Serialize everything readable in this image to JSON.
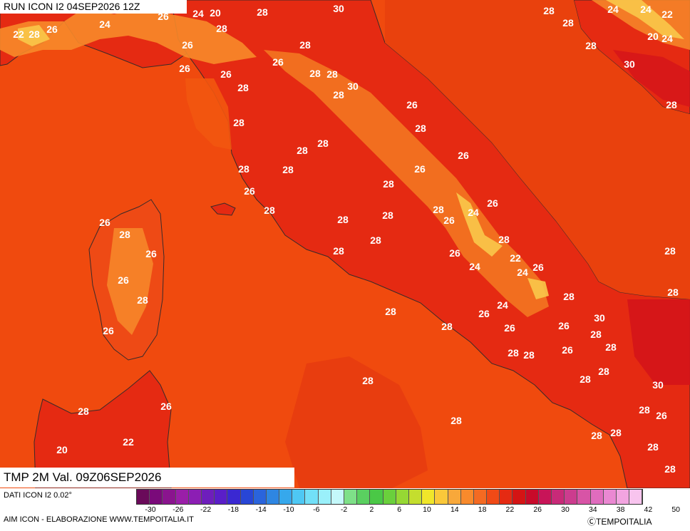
{
  "header": {
    "run": "RUN ICON I2 04SEP2026 12Z",
    "variable": "TMP 2M Val. 09Z06SEP2026"
  },
  "map": {
    "colors": {
      "sea": "#f04a0e",
      "land_hot": "#e52a12",
      "land_warm": "#ee4a15",
      "mountain": "#f78a2a",
      "peak": "#f9c84a",
      "coast": "#3a2a2a",
      "border": "#8a6a6a",
      "label": "#ffffff"
    },
    "labels": [
      "28",
      "30",
      "26",
      "24",
      "20",
      "22",
      "28",
      "26",
      "24",
      "28",
      "26",
      "26",
      "28",
      "26",
      "28",
      "28",
      "26",
      "28",
      "30",
      "28",
      "26",
      "28",
      "28",
      "28",
      "28",
      "26",
      "28",
      "28",
      "26",
      "26",
      "28",
      "28",
      "28",
      "28",
      "28",
      "28",
      "28",
      "26",
      "24",
      "26",
      "26",
      "28",
      "26",
      "26",
      "28",
      "26",
      "28",
      "22",
      "24",
      "26",
      "26",
      "24",
      "28",
      "28",
      "26",
      "28",
      "28",
      "24",
      "26",
      "26",
      "28",
      "30",
      "28",
      "28",
      "26",
      "28",
      "28",
      "30",
      "28",
      "26",
      "28",
      "28",
      "28",
      "28",
      "28",
      "28",
      "28",
      "26",
      "20",
      "22",
      "24",
      "20",
      "24",
      "22",
      "24",
      "28",
      "28",
      "28",
      "30",
      "28",
      "28",
      "28"
    ]
  },
  "legend": {
    "title": "DATI ICON I2 0.02°",
    "credit": "AIM ICON - ELABORAZIONE WWW.TEMPOITALIA.IT",
    "copyright": "ⒸTEMPOITALIA",
    "ticks": [
      "-30",
      "-26",
      "-22",
      "-18",
      "-14",
      "-10",
      "-6",
      "-2",
      "2",
      "6",
      "10",
      "14",
      "18",
      "22",
      "26",
      "30",
      "34",
      "38",
      "42",
      "50"
    ],
    "colors": [
      "#6a0a5a",
      "#7a0a7a",
      "#8a148e",
      "#9a1ea8",
      "#8c1eb4",
      "#6e1ebc",
      "#5a1ec8",
      "#3a28d2",
      "#2846d6",
      "#2a64dc",
      "#2e86e2",
      "#36a8ec",
      "#4ec8f4",
      "#72e0f8",
      "#9af0fa",
      "#c4f8fa",
      "#7ee088",
      "#5ad060",
      "#4ac846",
      "#6ad03c",
      "#96d834",
      "#c4de2e",
      "#f0e62a",
      "#fac83a",
      "#f8a83a",
      "#f88a2c",
      "#f46a22",
      "#f04a16",
      "#e52a12",
      "#d41414",
      "#c80a2a",
      "#c81458",
      "#c82a78",
      "#cc3c8e",
      "#d854a6",
      "#e06cbe",
      "#ea88d2",
      "#f2a4e0",
      "#f8c4ee"
    ]
  }
}
